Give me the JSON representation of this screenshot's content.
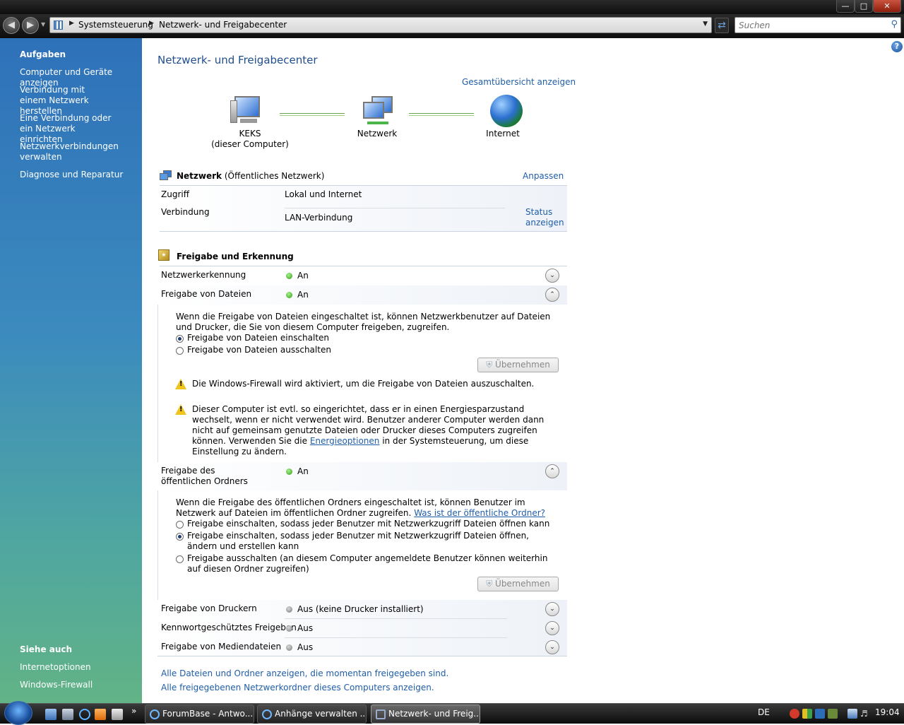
{
  "window": {
    "address": {
      "crumbs": [
        "Systemsteuerung",
        "Netzwerk- und Freigabecenter"
      ]
    },
    "search_placeholder": "Suchen"
  },
  "sidebar": {
    "tasks_heading": "Aufgaben",
    "tasks": [
      {
        "label": "Computer und Geräte anzeigen"
      },
      {
        "label": "Verbindung mit einem Netzwerk herstellen"
      },
      {
        "label": "Eine Verbindung oder ein Netzwerk einrichten"
      },
      {
        "label": "Netzwerkverbindungen verwalten"
      },
      {
        "label": "Diagnose und Reparatur"
      }
    ],
    "see_also_heading": "Siehe auch",
    "see_also": [
      {
        "label": "Internetoptionen"
      },
      {
        "label": "Windows-Firewall"
      }
    ]
  },
  "main": {
    "title": "Netzwerk- und Freigabecenter",
    "full_map_link": "Gesamtübersicht anzeigen",
    "map": {
      "computer_name": "KEKS",
      "computer_sub": "(dieser Computer)",
      "network": "Netzwerk",
      "internet": "Internet"
    },
    "network_section": {
      "name": "Netzwerk",
      "type": "(Öffentliches Netzwerk)",
      "customize": "Anpassen",
      "access_label": "Zugriff",
      "access_value": "Lokal und Internet",
      "connection_label": "Verbindung",
      "connection_value": "LAN-Verbindung",
      "status_link": "Status anzeigen"
    },
    "sharing": {
      "heading": "Freigabe und Erkennung",
      "network_discovery": {
        "label": "Netzwerkerkennung",
        "value": "An"
      },
      "file_sharing": {
        "label": "Freigabe von Dateien",
        "value": "An",
        "description": "Wenn die Freigabe von Dateien eingeschaltet ist, können Netzwerkbenutzer auf Dateien und Drucker, die Sie von diesem Computer freigeben, zugreifen.",
        "options": [
          "Freigabe von Dateien einschalten",
          "Freigabe von Dateien ausschalten"
        ],
        "selected": 0,
        "apply": "Übernehmen",
        "warning_firewall": "Die Windows-Firewall wird aktiviert, um die Freigabe von Dateien auszuschalten.",
        "warning_power_1": "Dieser Computer ist evtl. so eingerichtet, dass er in einen Energiesparzustand wechselt, wenn er nicht verwendet wird. Benutzer anderer Computer werden dann nicht auf gemeinsam genutzte Dateien oder Drucker dieses Computers zugreifen können. Verwenden Sie die",
        "warning_power_link": "Energieoptionen",
        "warning_power_2": "in der Systemsteuerung, um diese Einstellung zu ändern."
      },
      "public_folder": {
        "label": "Freigabe des öffentlichen Ordners",
        "value": "An",
        "description": "Wenn die Freigabe des öffentlichen Ordners eingeschaltet ist, können Benutzer im Netzwerk auf Dateien im öffentlichen Ordner zugreifen.",
        "help_link": "Was ist der öffentliche Ordner?",
        "options": [
          "Freigabe einschalten, sodass jeder Benutzer mit Netzwerkzugriff Dateien öffnen kann",
          "Freigabe einschalten, sodass jeder Benutzer mit Netzwerkzugriff Dateien öffnen, ändern und erstellen kann",
          "Freigabe ausschalten (an diesem Computer angemeldete Benutzer können weiterhin auf diesen Ordner zugreifen)"
        ],
        "selected": 1,
        "apply": "Übernehmen"
      },
      "printer_sharing": {
        "label": "Freigabe von Druckern",
        "value": "Aus (keine Drucker installiert)"
      },
      "password_sharing": {
        "label": "Kennwortgeschütztes Freigeben",
        "value": "Aus"
      },
      "media_sharing": {
        "label": "Freigabe von Mediendateien",
        "value": "Aus"
      }
    },
    "bottom_links": [
      "Alle Dateien und Ordner anzeigen, die momentan freigegeben sind.",
      "Alle freigegebenen Netzwerkordner dieses Computers anzeigen."
    ]
  },
  "taskbar": {
    "chevron": "»",
    "tasks": [
      {
        "label": "ForumBase - Antwo..."
      },
      {
        "label": "Anhänge verwalten ..."
      },
      {
        "label": "Netzwerk- und Freig..."
      }
    ],
    "language": "DE",
    "clock": "19:04"
  },
  "colors": {
    "accent": "#1f4e8d",
    "link": "#1f5da8",
    "sidebar_top": "#2e71b9",
    "sidebar_bottom": "#62b386"
  }
}
